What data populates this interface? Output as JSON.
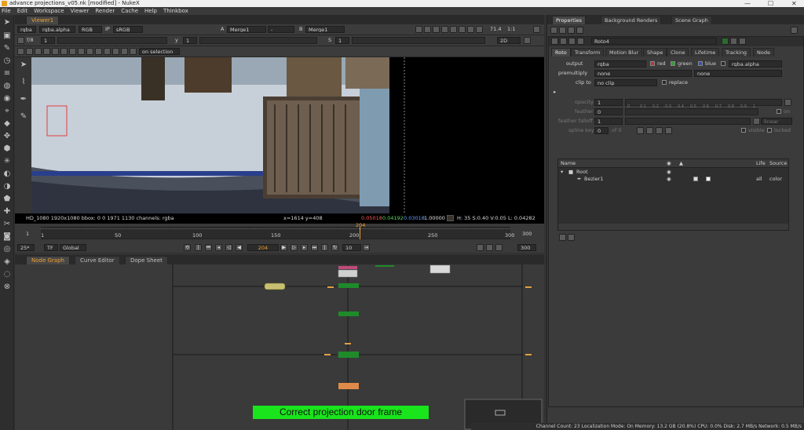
{
  "window": {
    "title": "advance projections_v05.nk [modified] - NukeX",
    "min": "—",
    "max": "☐",
    "close": "✕"
  },
  "menu": [
    "File",
    "Edit",
    "Workspace",
    "Viewer",
    "Render",
    "Cache",
    "Help",
    "Thinkbox"
  ],
  "viewer": {
    "tab": "Viewer1",
    "channels": "rgba",
    "layer": "rgba.alpha",
    "display": "RGB",
    "lut_label": "IP",
    "lut": "sRGB",
    "input_a_label": "A",
    "input_a": "Merge1",
    "input_dash": "-",
    "input_b_label": "B",
    "input_b": "Merge1",
    "zoom": "71.4",
    "ratio": "1:1",
    "mode": "2D",
    "fstop_label": "f/8",
    "gain": "1",
    "gamma_label": "y",
    "gamma": "1",
    "frame_label": "S",
    "frame": "1",
    "roi_label": "on selection",
    "info": "HD_1080 1920x1080  bbox: 0 0 1971 1130 channels: rgba",
    "coords": "x=1614 y=408",
    "r": "0.05018",
    "g": "0.04192",
    "b": "0.03018",
    "a": "1.00000",
    "hsv": "H: 35 S:0.40 V:0.05  L: 0.04282"
  },
  "timeline": {
    "ticks": [
      "1",
      "50",
      "100",
      "150",
      "200",
      "250",
      "300"
    ],
    "current": "204",
    "start": "1",
    "end": "300",
    "fps": "25*",
    "tf": "TF",
    "scope": "Global",
    "frame_field": "204",
    "step": "10",
    "end_field": "300"
  },
  "nodegraph_tabs": [
    "Node Graph",
    "Curve Editor",
    "Dope Sheet"
  ],
  "subtitle": "Correct projection door frame",
  "properties": {
    "tabs": [
      "Properties",
      "Background Renders",
      "Scene Graph"
    ],
    "node_name": "Roto4",
    "node_tabs": [
      "Roto",
      "Transform",
      "Motion Blur",
      "Shape",
      "Clone",
      "Lifetime",
      "Tracking",
      "Node"
    ],
    "output_label": "output",
    "output": "rgba",
    "red": "red",
    "green": "green",
    "blue": "blue",
    "alpha": "rgba.alpha",
    "premultiply_label": "premultiply",
    "premultiply": "none",
    "premultiply2": "none",
    "clipto_label": "clip to",
    "clipto": "no clip",
    "replace": "replace",
    "opacity_label": "opacity",
    "opacity": "1",
    "feather_label": "feather",
    "feather": "0",
    "on": "on",
    "falloff_label": "feather falloff",
    "falloff": "1",
    "falloff_mode": "linear",
    "splinekey_label": "spline key",
    "splinekey": "0",
    "of": "of 0",
    "visible": "visible",
    "locked": "locked",
    "ticks": [
      "0",
      "0.1",
      "0.2",
      "0.3",
      "0.4",
      "0.5",
      "0.6",
      "0.7",
      "0.8",
      "0.9",
      "1"
    ],
    "table_headers": [
      "Name",
      "Life",
      "Source"
    ],
    "rows": [
      {
        "name": "Root",
        "life": "",
        "source": ""
      },
      {
        "name": "Bezier1",
        "life": "all",
        "source": "color"
      }
    ]
  },
  "status": "Channel Count: 23  Localization Mode: On  Memory: 13.2 GB (20.8%)  CPU: 0.0%  Disk: 2.7 MB/s  Network: 0.5 MB/s"
}
